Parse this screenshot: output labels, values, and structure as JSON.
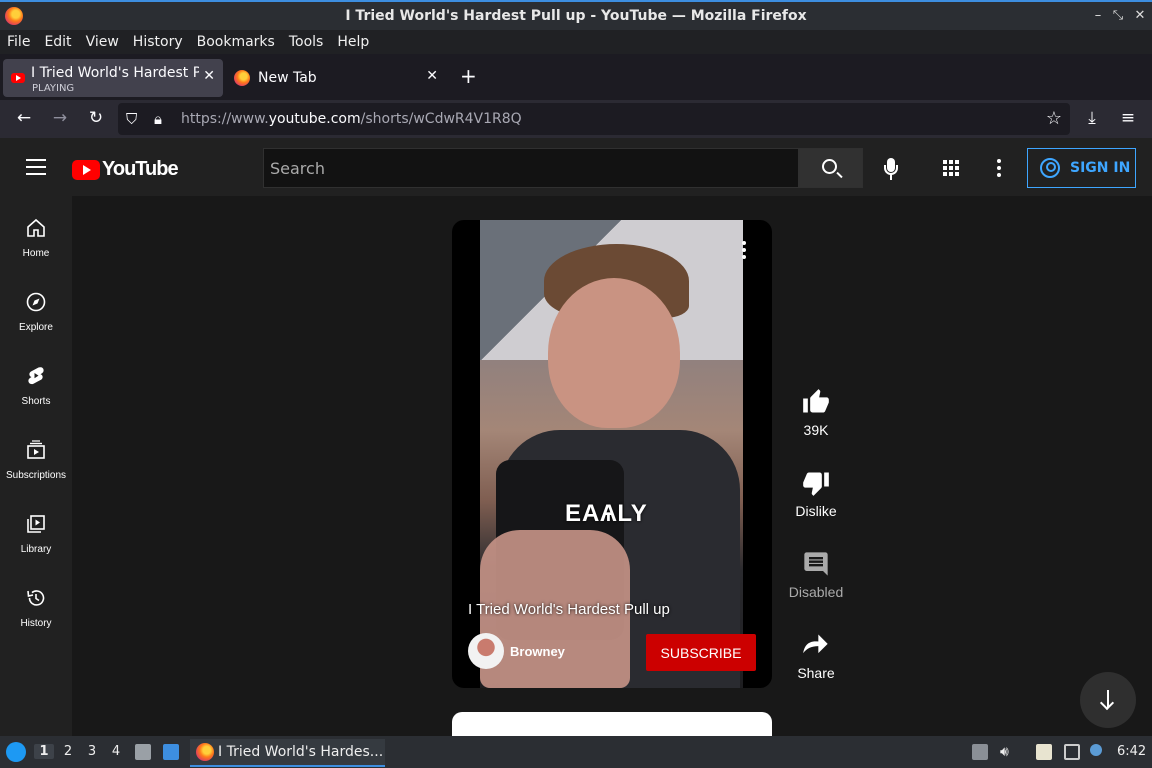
{
  "window": {
    "title": "I Tried World's Hardest Pull up - YouTube — Mozilla Firefox"
  },
  "menu": [
    "File",
    "Edit",
    "View",
    "History",
    "Bookmarks",
    "Tools",
    "Help"
  ],
  "tabs": [
    {
      "label": "I Tried World's Hardest Pu",
      "sub": "PLAYING"
    },
    {
      "label": "New Tab"
    }
  ],
  "url": {
    "prefix": "https://www.",
    "host": "youtube.com",
    "path": "/shorts/wCdwR4V1R8Q"
  },
  "youtube": {
    "logo_text": "YouTube",
    "search_placeholder": "Search",
    "sign_in": "SIGN IN",
    "sidebar": [
      {
        "label": "Home",
        "icon": "home-icon"
      },
      {
        "label": "Explore",
        "icon": "compass-icon"
      },
      {
        "label": "Shorts",
        "icon": "shorts-icon"
      },
      {
        "label": "Subscriptions",
        "icon": "subscriptions-icon"
      },
      {
        "label": "Library",
        "icon": "library-icon"
      },
      {
        "label": "History",
        "icon": "history-icon"
      }
    ],
    "short": {
      "overlay_caption": "EAѦLY",
      "title": "I Tried World's Hardest Pull up",
      "channel": "Browney",
      "subscribe": "SUBSCRIBE"
    },
    "actions": {
      "likes": "39K",
      "dislike": "Dislike",
      "comments": "Disabled",
      "share": "Share"
    }
  },
  "taskbar": {
    "workspaces": [
      "1",
      "2",
      "3",
      "4"
    ],
    "task_title": "I Tried World's Hardes...",
    "clock": "6:42"
  },
  "colors": {
    "youtube_red": "#ff0000",
    "subscribe_red": "#cc0000",
    "sign_in_blue": "#3ea6ff",
    "taskbar_accent": "#3d8ee0"
  }
}
